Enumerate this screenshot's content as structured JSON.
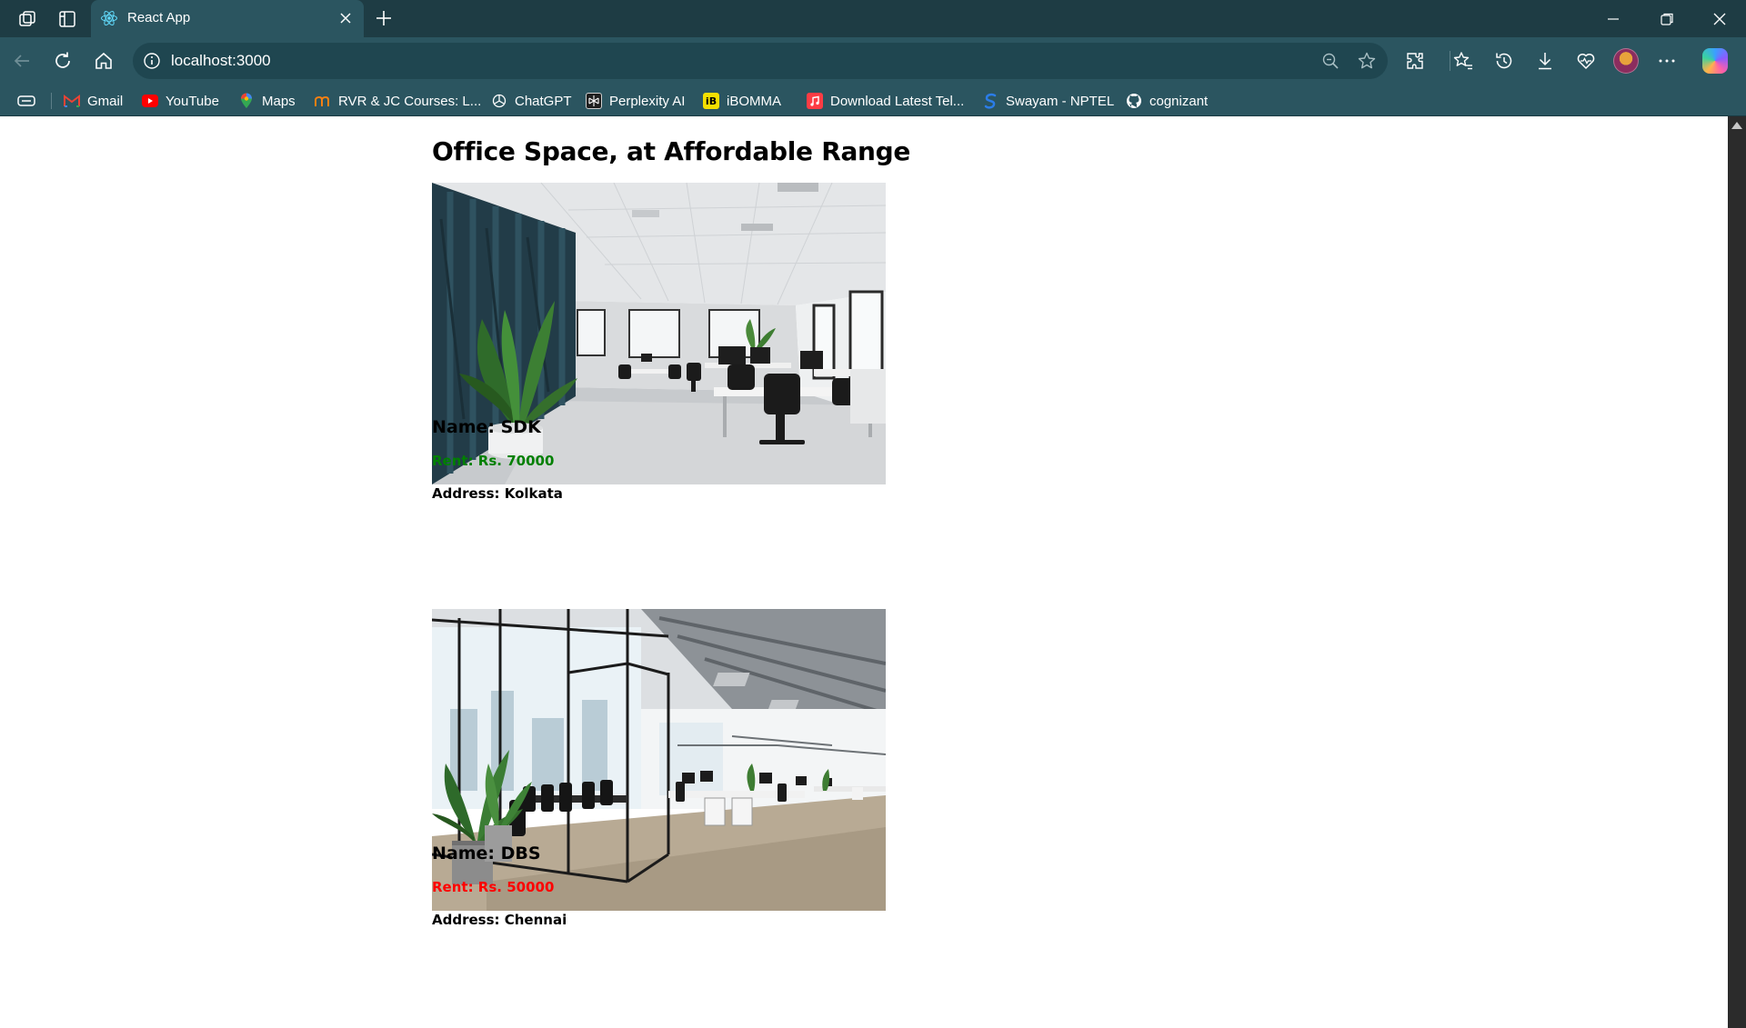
{
  "browser": {
    "tab_title": "React App",
    "url": "localhost:3000",
    "bookmarks": [
      {
        "label": "Gmail",
        "icon": "gmail-icon",
        "color": "#ea4335"
      },
      {
        "label": "YouTube",
        "icon": "youtube-icon",
        "color": "#ff0000"
      },
      {
        "label": "Maps",
        "icon": "maps-icon",
        "color": "#34a853"
      },
      {
        "label": "RVR & JC Courses: L...",
        "icon": "moodle-icon",
        "color": "#f98012"
      },
      {
        "label": "ChatGPT",
        "icon": "chatgpt-icon",
        "color": "#ffffff"
      },
      {
        "label": "Perplexity AI",
        "icon": "perplexity-icon",
        "color": "#1f1f1f"
      },
      {
        "label": "iBOMMA",
        "icon": "ibomma-icon",
        "color": "#f5e000"
      },
      {
        "label": "Download Latest Tel...",
        "icon": "music-icon",
        "color": "#fc3c44"
      },
      {
        "label": "Swayam - NPTEL",
        "icon": "swayam-icon",
        "color": "#2b7de9"
      },
      {
        "label": "cognizant",
        "icon": "github-icon",
        "color": "#ffffff"
      }
    ]
  },
  "page": {
    "heading": "Office Space, at Affordable Range",
    "offices": [
      {
        "name": "Name: SDK",
        "rent": "Rent: Rs. 70000",
        "address": "Address: Kolkata",
        "rent_color": "#008000",
        "image": "office-interior-photo-1"
      },
      {
        "name": "Name: DBS",
        "rent": "Rent: Rs. 50000",
        "address": "Address: Chennai",
        "rent_color": "#ff0000",
        "image": "office-interior-photo-2"
      }
    ]
  }
}
